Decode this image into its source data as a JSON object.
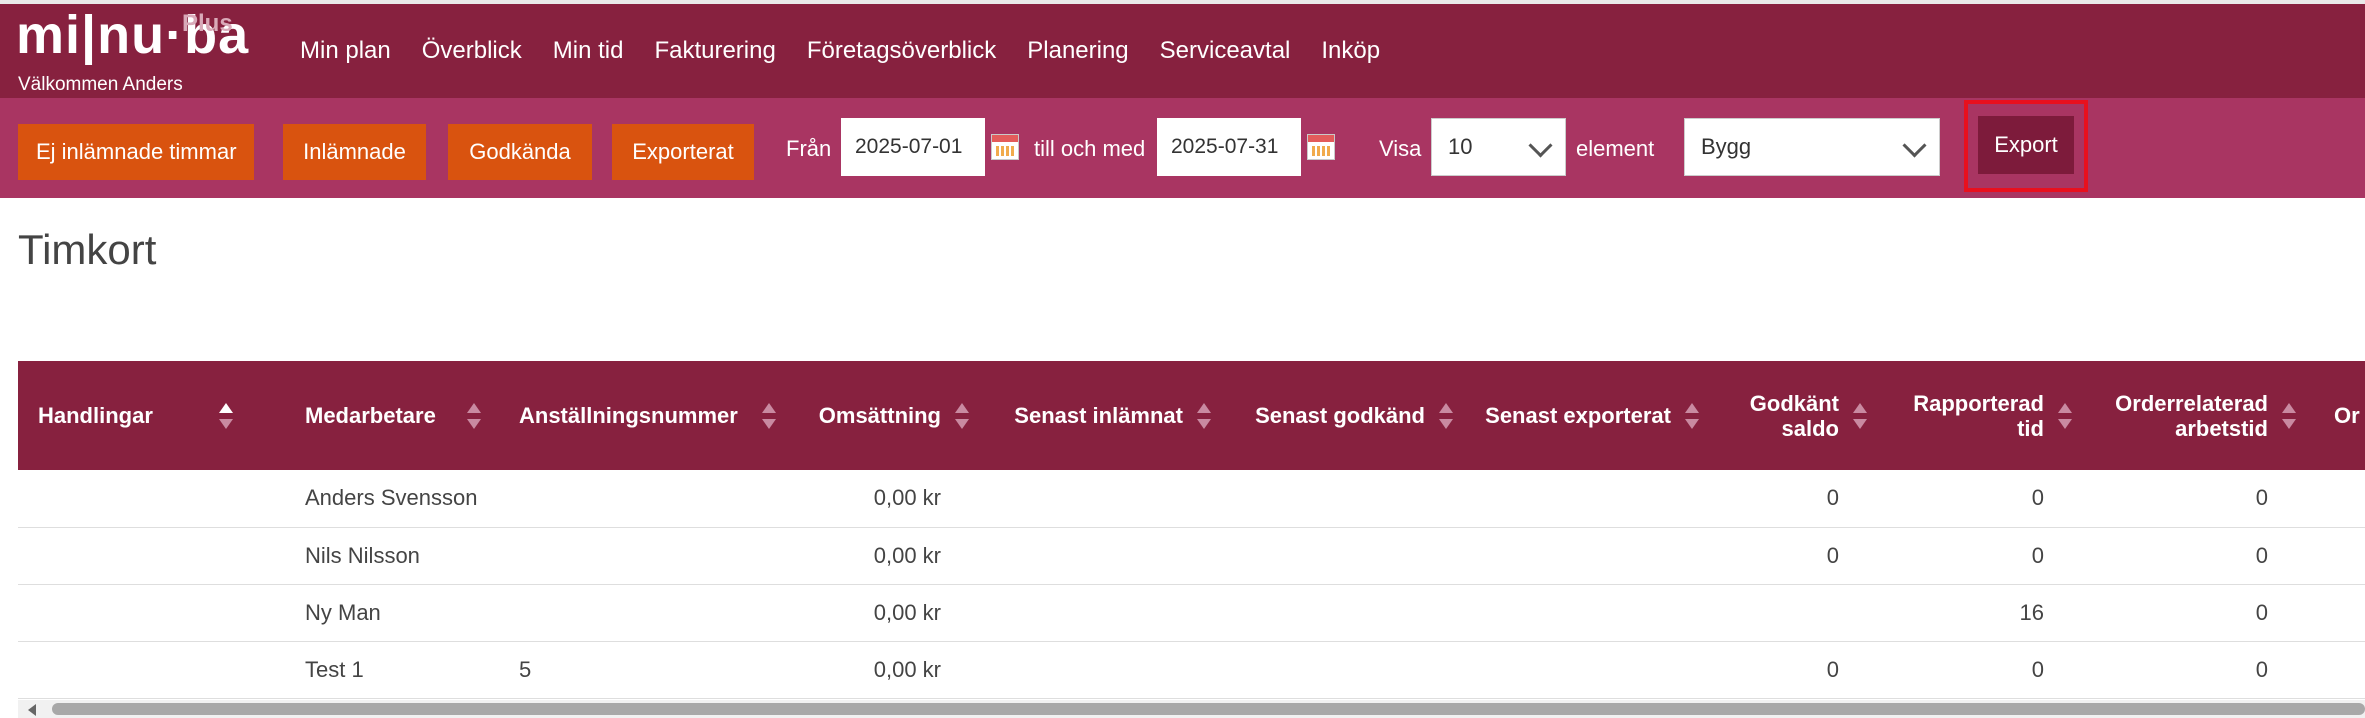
{
  "header": {
    "logo_text": "mi|nu·ba",
    "logo_plus": "Plus",
    "welcome": "Välkommen  Anders",
    "nav": [
      "Min plan",
      "Överblick",
      "Min tid",
      "Fakturering",
      "Företagsöverblick",
      "Planering",
      "Serviceavtal",
      "Inköp"
    ]
  },
  "toolbar": {
    "filters": [
      "Ej inlämnade timmar",
      "Inlämnade",
      "Godkända",
      "Exporterat"
    ],
    "from_label": "Från",
    "from_value": "2025-07-01",
    "to_label": "till och med",
    "to_value": "2025-07-31",
    "show_label": "Visa",
    "show_value": "10",
    "element_label": "element",
    "category_value": "Bygg",
    "export_label": "Export"
  },
  "page": {
    "title": "Timkort"
  },
  "table": {
    "columns": [
      [
        "Handlingar"
      ],
      [
        "Medarbetare"
      ],
      [
        "Anställningsnummer"
      ],
      [
        "Omsättning"
      ],
      [
        "Senast inlämnat"
      ],
      [
        "Senast godkänd"
      ],
      [
        "Senast exporterat"
      ],
      [
        "Godkänt",
        "saldo"
      ],
      [
        "Rapporterad",
        "tid"
      ],
      [
        "Orderrelaterad",
        "arbetstid"
      ],
      [
        "Or"
      ]
    ],
    "rows": [
      [
        "",
        "Anders Svensson",
        "",
        "0,00 kr",
        "",
        "",
        "",
        "0",
        "0",
        "0",
        ""
      ],
      [
        "",
        "Nils Nilsson",
        "",
        "0,00 kr",
        "",
        "",
        "",
        "0",
        "0",
        "0",
        ""
      ],
      [
        "",
        "Ny Man",
        "",
        "0,00 kr",
        "",
        "",
        "",
        "",
        "16",
        "0",
        ""
      ],
      [
        "",
        "Test 1",
        "5",
        "0,00 kr",
        "",
        "",
        "",
        "0",
        "0",
        "0",
        ""
      ]
    ]
  },
  "colors": {
    "header_bg": "#87213f",
    "toolbar_bg": "#a93562",
    "filter_button": "#d9530f",
    "export_button": "#7d1b3b",
    "highlight": "#e8101e"
  }
}
